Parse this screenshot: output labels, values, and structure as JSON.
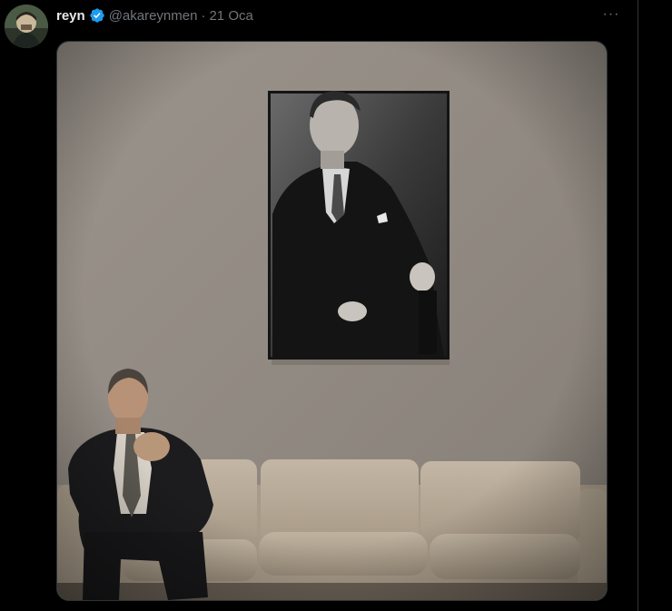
{
  "tweet": {
    "display_name": "reyn",
    "handle": "@akareynmen",
    "separator": "·",
    "timestamp": "21 Oca",
    "more_label": "···"
  },
  "colors": {
    "background": "#000000",
    "name": "#e7e9ea",
    "secondary": "#71767b",
    "verified": "#1d9bf0",
    "divider": "#2f3336"
  },
  "icons": {
    "verified": "verified-badge-icon",
    "more": "more-options-icon"
  }
}
